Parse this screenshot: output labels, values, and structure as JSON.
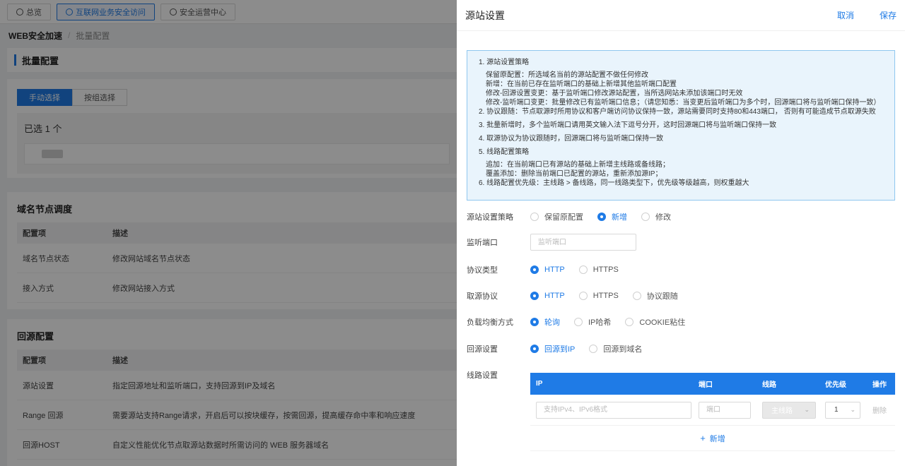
{
  "top_tabs": [
    {
      "label": "总览"
    },
    {
      "label": "互联网业务安全访问"
    },
    {
      "label": "安全运营中心"
    }
  ],
  "breadcrumb": {
    "root": "WEB安全加速",
    "sep": "/",
    "current": "批量配置"
  },
  "page_header": {
    "title": "批量配置"
  },
  "select_mode": {
    "manual": "手动选择",
    "group": "按组选择"
  },
  "selected": {
    "title": "已选 1 个"
  },
  "domain_section": {
    "title": "域名节点调度",
    "headers": [
      "配置项",
      "描述"
    ],
    "rows": [
      [
        "域名节点状态",
        "修改网站域名节点状态"
      ],
      [
        "接入方式",
        "修改网站接入方式"
      ]
    ]
  },
  "origin_section": {
    "title": "回源配置",
    "headers": [
      "配置项",
      "描述"
    ],
    "rows": [
      [
        "源站设置",
        "指定回源地址和监听端口，支持回源到IP及域名"
      ],
      [
        "Range 回源",
        "需要源站支持Range请求，开启后可以按块缓存，按需回源，提高缓存命中率和响应速度"
      ],
      [
        "回源HOST",
        "自定义性能优化节点取源站数据时所需访问的 WEB 服务器域名"
      ]
    ]
  },
  "drawer": {
    "title": "源站设置",
    "cancel": "取消",
    "save": "保存",
    "info": {
      "l1": "1. 源站设置策略",
      "l1a": "保留原配置：所选域名当前的源站配置不做任何修改",
      "l1b": "新增：在当前已存在监听端口的基础上新增其他监听端口配置",
      "l1c": "修改-回源设置变更：基于监听端口修改源站配置，当所选网站未添加该端口时无效",
      "l1d": "修改-监听端口变更：批量修改已有监听端口信息；（请您知悉：当变更后监听端口为多个时，回源端口将与监听端口保持一致）",
      "l2": "2. 协议跟随：节点取源时所用协议和客户端访问协议保持一致，源站需要同时支持80和443端口， 否则有可能造成节点取源失败",
      "l3": "3. 批量新增时，多个监听端口请用英文输入法下逗号分开，这时回源端口将与监听端口保持一致",
      "l4": "4. 取源协议为协议跟随时，回源端口将与监听端口保持一致",
      "l5": "5. 线路配置策略",
      "l5a": "追加：在当前端口已有源站的基础上新增主线路或备线路；",
      "l5b": "覆盖添加：删除当前端口已配置的源站，重新添加源IP；",
      "l6": "6. 线路配置优先级：主线路 > 备线路，同一线路类型下，优先级等级越高，则权重越大"
    },
    "form": {
      "strategy": {
        "label": "源站设置策略",
        "options": [
          "保留原配置",
          "新增",
          "修改"
        ],
        "selected": "新增"
      },
      "listen_port": {
        "label": "监听端口",
        "placeholder": "监听端口"
      },
      "protocol": {
        "label": "协议类型",
        "options": [
          "HTTP",
          "HTTPS"
        ],
        "selected": "HTTP"
      },
      "origin_protocol": {
        "label": "取源协议",
        "options": [
          "HTTP",
          "HTTPS",
          "协议跟随"
        ],
        "selected": "HTTP"
      },
      "lb": {
        "label": "负载均衡方式",
        "options": [
          "轮询",
          "IP哈希",
          "COOKIE粘住"
        ],
        "selected": "轮询"
      },
      "origin": {
        "label": "回源设置",
        "options": [
          "回源到IP",
          "回源到域名"
        ],
        "selected": "回源到IP"
      },
      "lines": {
        "label": "线路设置",
        "headers": {
          "ip": "IP",
          "port": "端口",
          "line": "线路",
          "priority": "优先级",
          "op": "操作"
        },
        "row": {
          "ip_placeholder": "支持IPv4、IPv6格式",
          "port_placeholder": "端口",
          "line_value": "主线路",
          "priority_value": "1",
          "delete": "删除"
        },
        "add": "新增"
      }
    }
  },
  "colors": {
    "primary": "#1f7be6",
    "info_bg": "#e9f4fc",
    "info_border": "#8fc7ef"
  }
}
